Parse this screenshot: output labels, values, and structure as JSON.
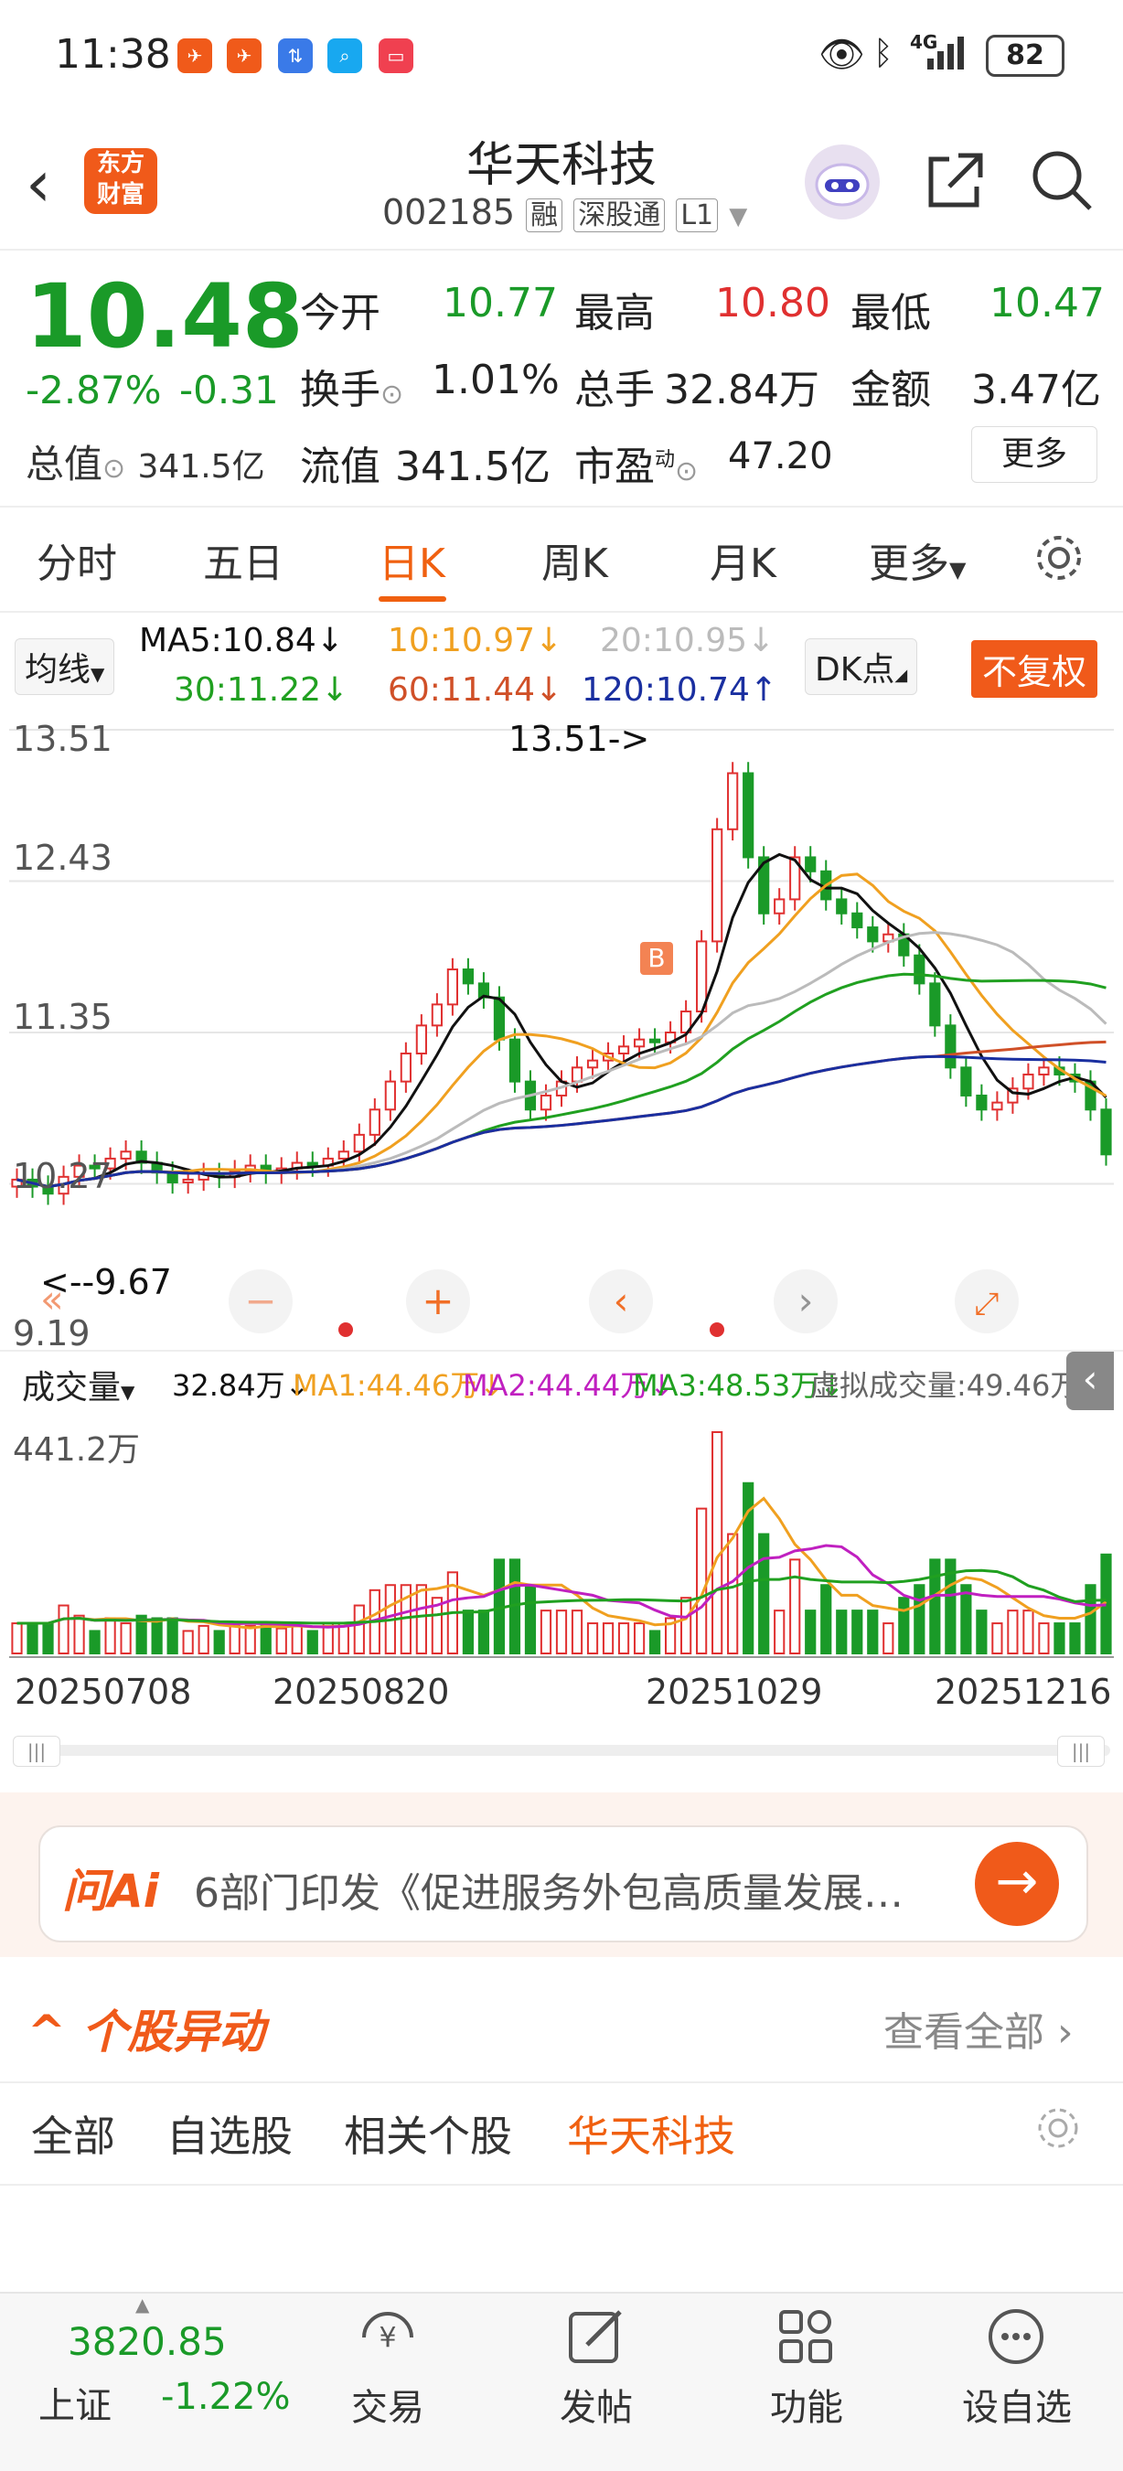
{
  "status_bar": {
    "time": "11:38",
    "battery": "82",
    "network": "4G"
  },
  "header": {
    "back_icon": "chevron-left-icon",
    "logo_line1": "东方",
    "logo_line2": "财富",
    "stock_name": "华天科技",
    "stock_code": "002185",
    "badges": [
      "融",
      "深股通",
      "L1"
    ]
  },
  "quote": {
    "price": "10.48",
    "change_pct": "-2.87%",
    "change_abs": "-0.31",
    "open_label": "今开",
    "open": "10.77",
    "high_label": "最高",
    "high": "10.80",
    "low_label": "最低",
    "low": "10.47",
    "turnover_label": "换手",
    "turnover": "1.01%",
    "volume_label": "总手",
    "volume": "32.84万",
    "amount_label": "金额",
    "amount": "3.47亿",
    "total_cap_label": "总值",
    "total_cap": "341.5亿",
    "float_cap_label": "流值",
    "float_cap": "341.5亿",
    "pe_label": "市盈",
    "pe_sup": "动",
    "pe": "47.20",
    "more_button": "更多"
  },
  "tabs": [
    "分时",
    "五日",
    "日K",
    "周K",
    "月K",
    "更多"
  ],
  "active_tab": "日K",
  "ma_bar": {
    "selector": "均线",
    "dk": "DK点",
    "fuquan": "不复权",
    "ma5": "MA5:10.84↓",
    "ma10": "10:10.97↓",
    "ma20": "20:10.95↓",
    "ma30": "30:11.22↓",
    "ma60": "60:11.44↓",
    "ma120": "120:10.74↑"
  },
  "chart_labels": {
    "y_ticks": [
      "13.51",
      "12.43",
      "11.35",
      "10.27",
      "9.19"
    ],
    "max_annotation": "13.51->",
    "min_annotation": "<--9.67",
    "volume_selector": "成交量",
    "vol_value": "32.84万↓",
    "vol_ma1": "MA1:44.46万↓",
    "vol_ma2": "MA2:44.44万↓",
    "vol_ma3": "MA3:48.53万↓",
    "virtual_vol": "虚拟成交量:49.46万",
    "vol_max": "441.2万",
    "dates": [
      "20250708",
      "20250820",
      "20251029",
      "20251216"
    ]
  },
  "colors": {
    "up": "#e03030",
    "down": "#1a9a28",
    "ma5": "#111111",
    "ma10": "#f0a020",
    "ma20": "#bbbbbb",
    "ma30": "#20a020",
    "ma60": "#d05028",
    "ma120": "#1a2fa0",
    "accent": "#f06010"
  },
  "chart_data": {
    "type": "candlestick",
    "y_range": [
      9.19,
      13.51
    ],
    "close_series": [
      10.3,
      10.25,
      10.2,
      10.32,
      10.4,
      10.38,
      10.45,
      10.5,
      10.42,
      10.35,
      10.28,
      10.3,
      10.34,
      10.32,
      10.36,
      10.4,
      10.35,
      10.38,
      10.42,
      10.4,
      10.45,
      10.5,
      10.62,
      10.8,
      11.0,
      11.2,
      11.4,
      11.55,
      11.8,
      11.7,
      11.6,
      11.3,
      11.0,
      10.8,
      10.9,
      11.0,
      11.1,
      11.15,
      11.2,
      11.25,
      11.3,
      11.28,
      11.35,
      11.5,
      12.0,
      12.8,
      13.2,
      12.6,
      12.2,
      12.3,
      12.6,
      12.5,
      12.3,
      12.2,
      12.1,
      12.0,
      12.05,
      11.9,
      11.7,
      11.4,
      11.1,
      10.9,
      10.8,
      10.85,
      10.95,
      11.05,
      11.1,
      11.05,
      11.0,
      10.8,
      10.48
    ]
  },
  "ai_bar": {
    "logo": "问Ai",
    "text": "6部门印发《促进服务外包高质量发展…"
  },
  "movement": {
    "title": "个股异动",
    "view_all": "查看全部",
    "filters": [
      "全部",
      "自选股",
      "相关个股",
      "华天科技"
    ],
    "active_filter": "华天科技"
  },
  "bottom_nav": {
    "index_value": "3820.85",
    "index_name": "上证",
    "index_change": "-1.22%",
    "items": [
      "交易",
      "发帖",
      "功能",
      "设自选"
    ]
  }
}
